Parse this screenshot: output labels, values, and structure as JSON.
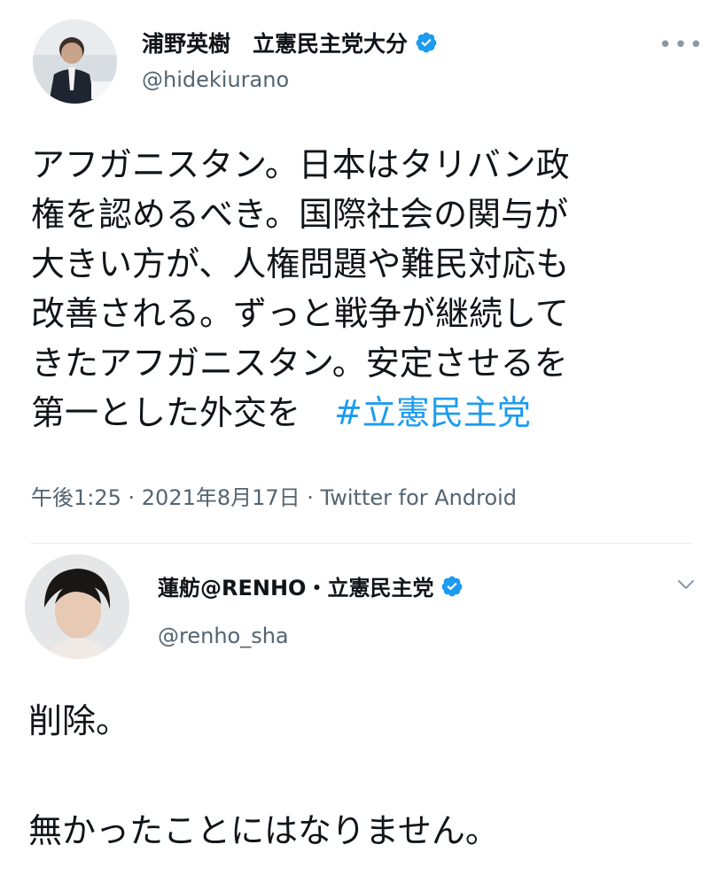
{
  "tweet": {
    "author_name": "浦野英樹　立憲民主党大分",
    "handle": "@hidekiurano",
    "more_label": "•••",
    "body_lines": [
      "アフガニスタン。日本はタリバン政",
      "権を認めるべき。国際社会の関与が",
      "大きい方が、人権問題や難民対応も",
      "改善される。ずっと戦争が継続して",
      "きたアフガニスタン。安定させるを"
    ],
    "body_last_line": "第一とした外交を　",
    "hashtag": "#立憲民主党",
    "meta": "午後1:25 · 2021年8月17日 · Twitter for Android"
  },
  "reply": {
    "author_name": "蓮舫@RENHO・立憲民主党",
    "handle": "@renho_sha",
    "line1": "削除。",
    "line2": "無かったことにはなりません。"
  },
  "colors": {
    "verified": "#1d9bf0",
    "hashtag": "#1d9bf0",
    "secondary_text": "#536471",
    "primary_text": "#0f1419"
  },
  "icons": {
    "verified": "verified-badge-icon",
    "more": "more-options-icon",
    "chevron": "chevron-down-icon"
  }
}
